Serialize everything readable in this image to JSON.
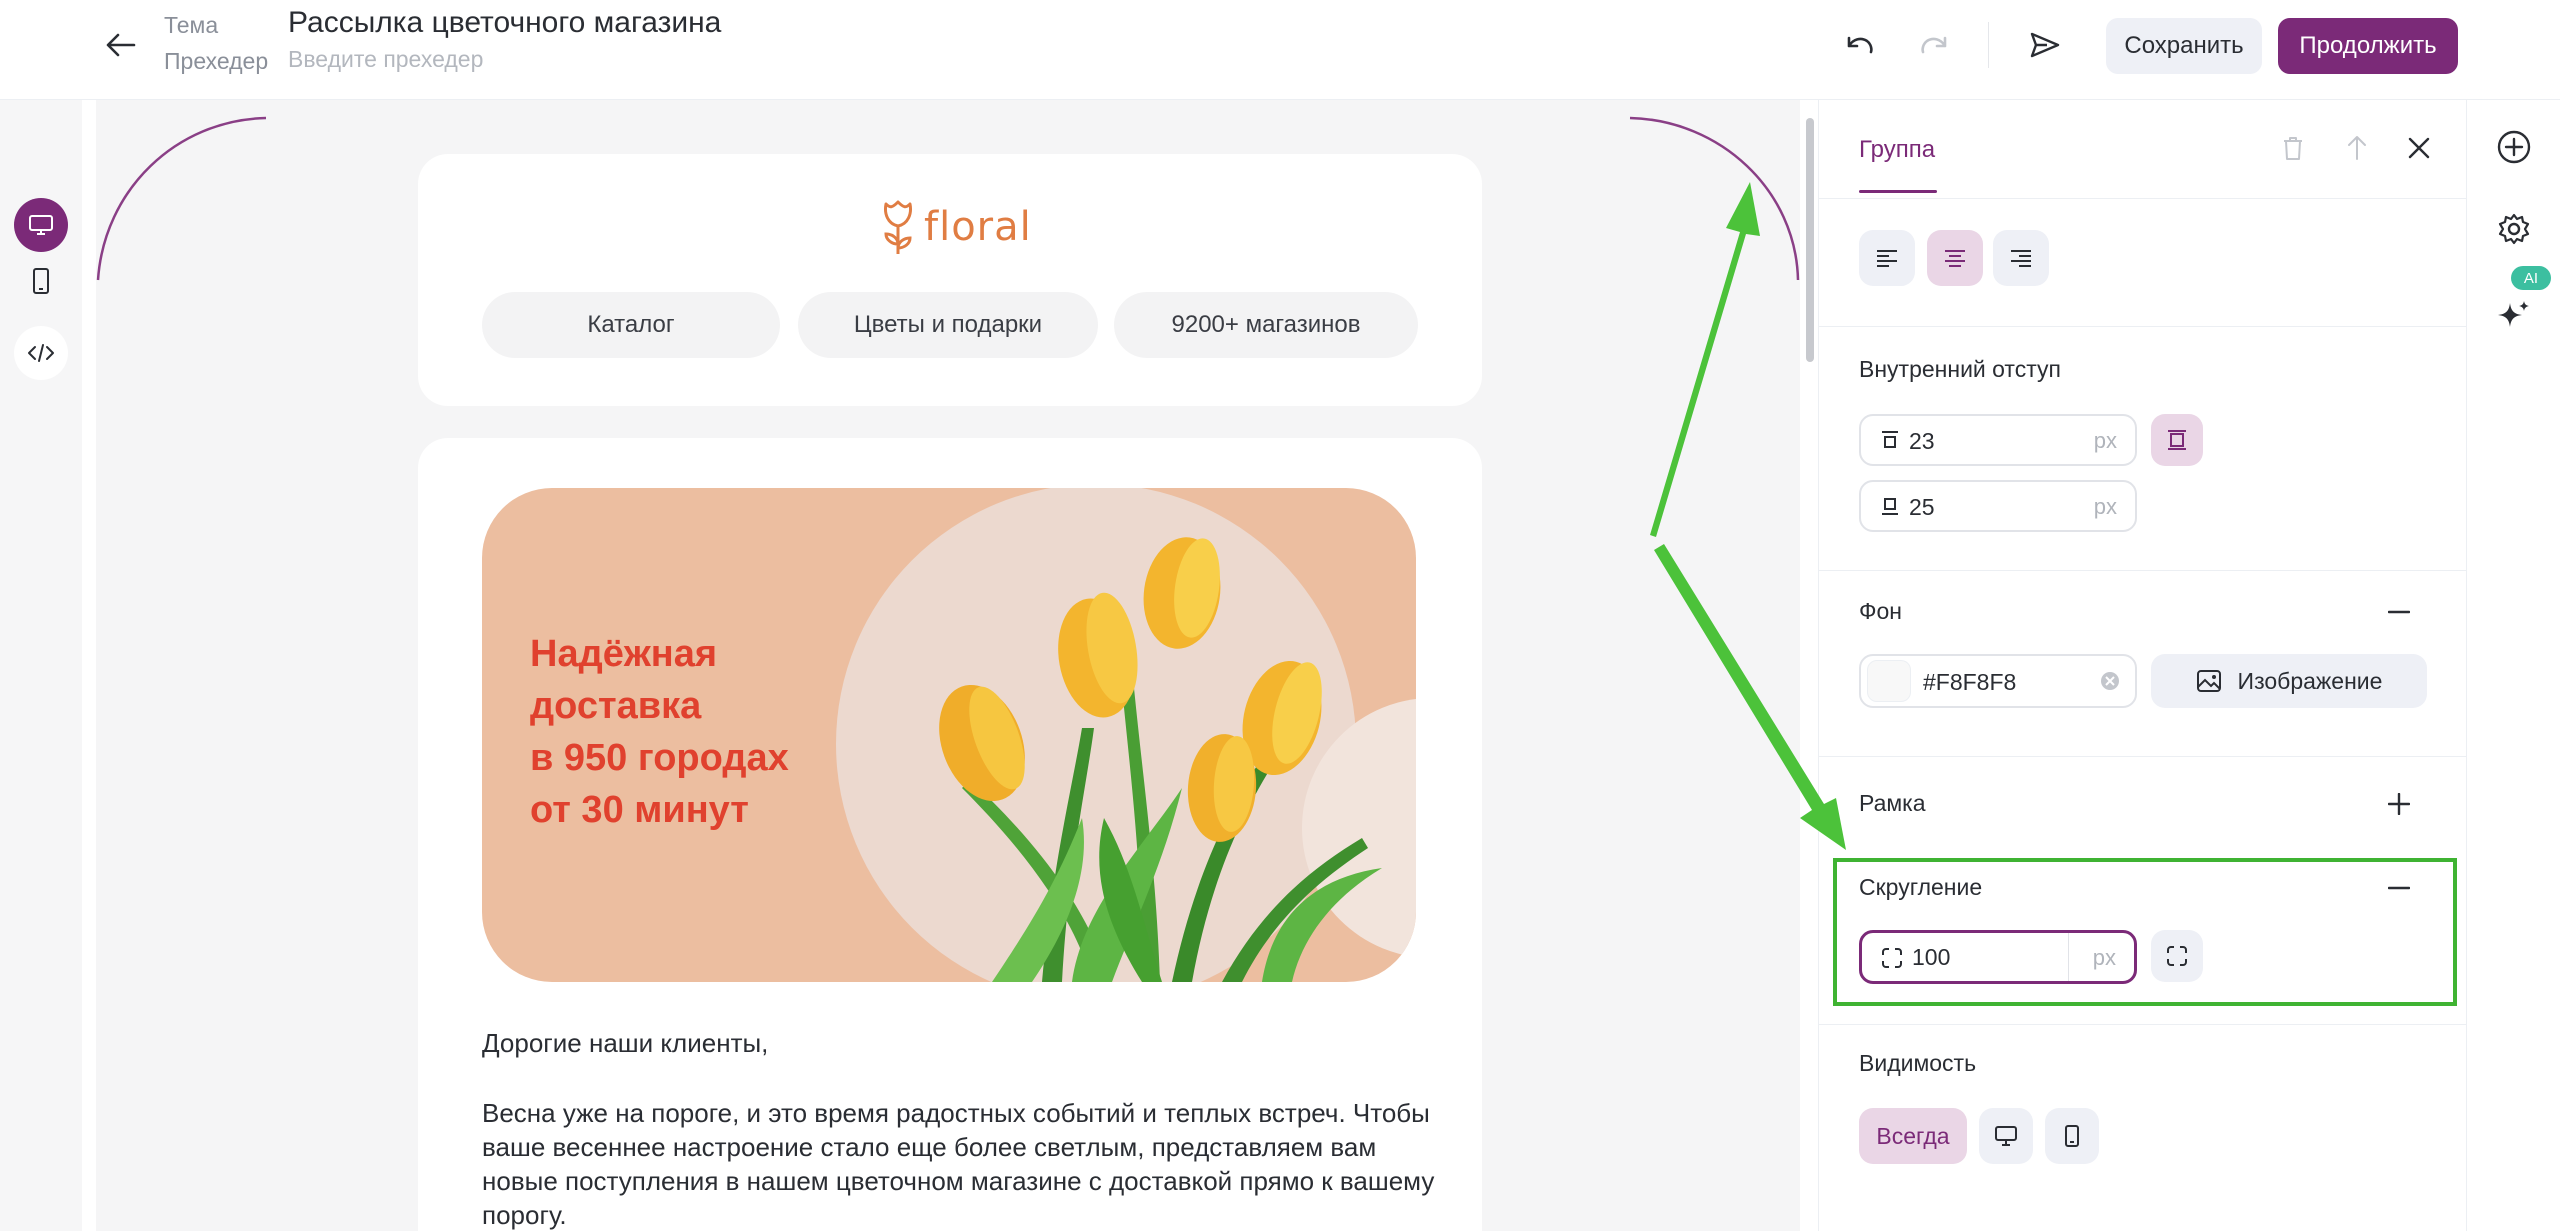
{
  "header": {
    "theme_label": "Тема",
    "subject": "Рассылка цветочного магазина",
    "preheader_label": "Прехедер",
    "preheader_placeholder": "Введите прехедер",
    "save_label": "Сохранить",
    "continue_label": "Продолжить"
  },
  "email": {
    "logo_text": "floral",
    "nav": [
      "Каталог",
      "Цветы и подарки",
      "9200+ магазинов"
    ],
    "banner_lines": [
      "Надёжная",
      "доставка",
      "в 950 городах",
      "от 30 минут"
    ],
    "greeting": "Дорогие наши клиенты,",
    "paragraph": "Весна уже на пороге, и это время радостных событий и теплых встреч. Чтобы ваше весеннее настроение стало еще более светлым, представляем вам новые поступления в нашем цветочном магазине с доставкой прямо к вашему порогу."
  },
  "panel": {
    "tab": "Группа",
    "padding": {
      "title": "Внутренний отступ",
      "top_value": "23",
      "bottom_value": "25",
      "unit": "px"
    },
    "background": {
      "title": "Фон",
      "color_value": "#F8F8F8",
      "image_label": "Изображение"
    },
    "border": {
      "title": "Рамка"
    },
    "rounding": {
      "title": "Скругление",
      "value": "100",
      "unit": "px"
    },
    "visibility": {
      "title": "Видимость",
      "always_label": "Всегда"
    }
  },
  "right_rail": {
    "ai_badge": "AI"
  },
  "colors": {
    "accent": "#7b2a78",
    "highlight": "#3fb332",
    "banner_bg": "#ecbea0",
    "banner_text": "#e0412e",
    "logo": "#e07d43"
  }
}
